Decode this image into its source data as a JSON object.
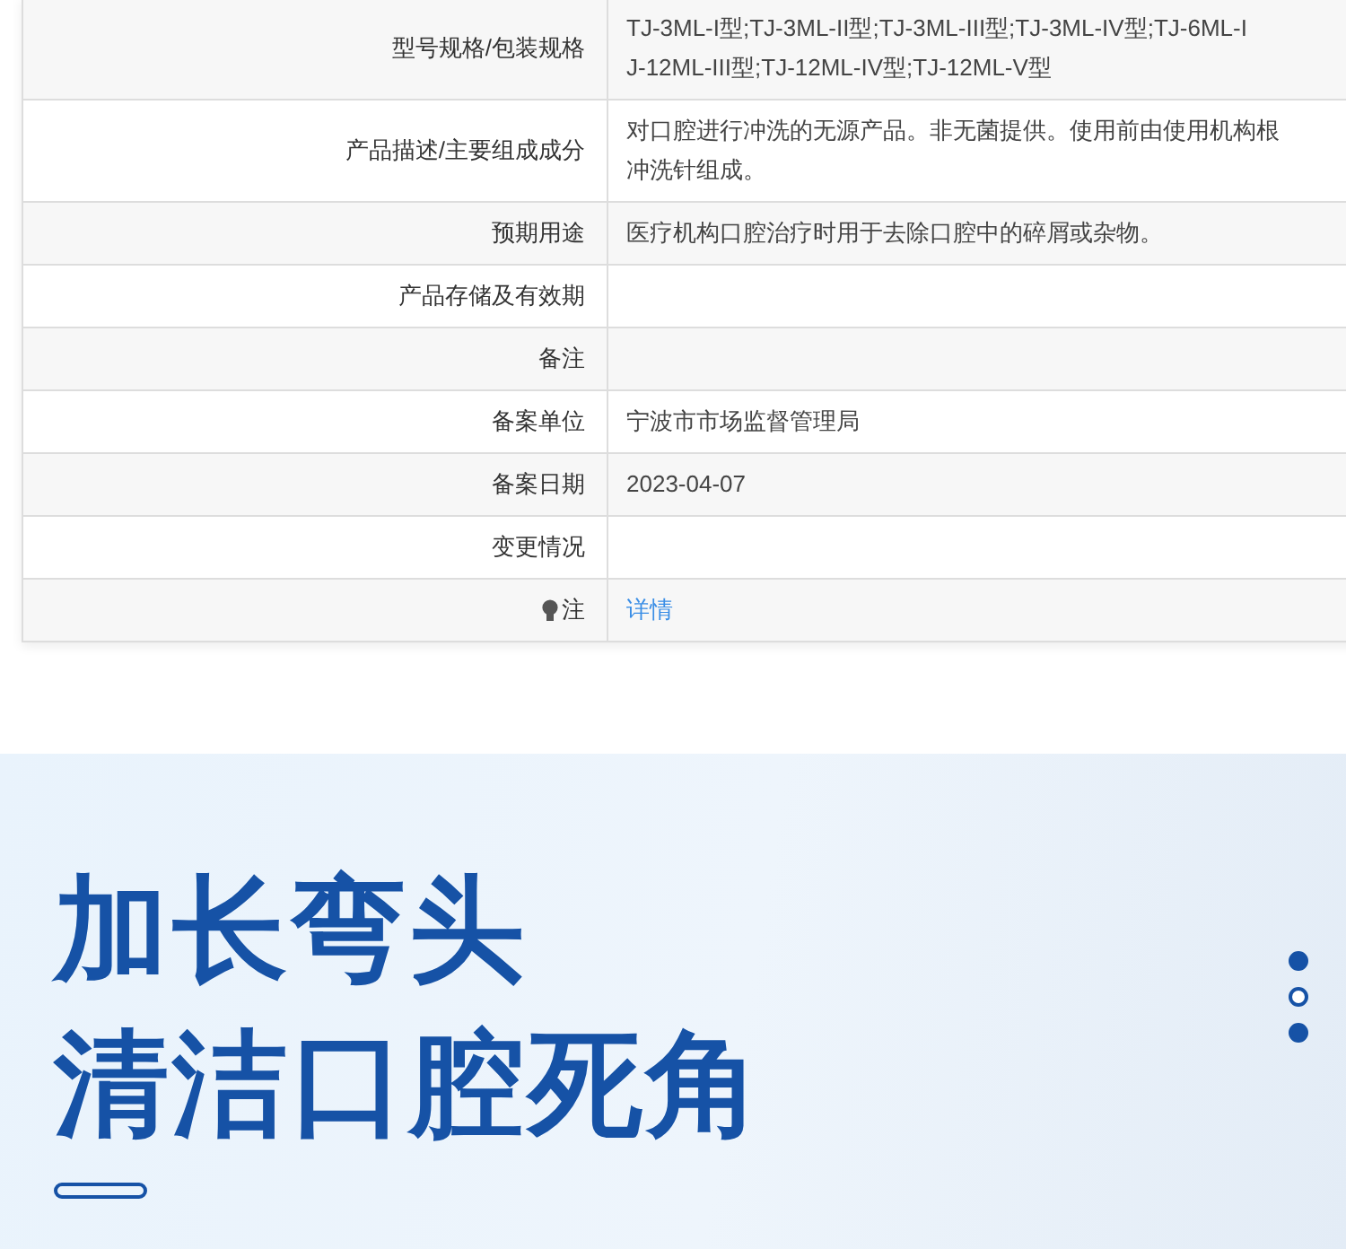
{
  "table": {
    "rows": [
      {
        "label": "型号规格/包装规格",
        "value": [
          "TJ-3ML-I型;TJ-3ML-II型;TJ-3ML-III型;TJ-3ML-IV型;TJ-6ML-I",
          "J-12ML-III型;TJ-12ML-IV型;TJ-12ML-V型"
        ]
      },
      {
        "label": "产品描述/主要组成成分",
        "value": [
          "对口腔进行冲洗的无源产品。非无菌提供。使用前由使用机构根",
          "冲洗针组成。"
        ]
      },
      {
        "label": "预期用途",
        "value": [
          "医疗机构口腔治疗时用于去除口腔中的碎屑或杂物。"
        ]
      },
      {
        "label": "产品存储及有效期"
      },
      {
        "label": "备注"
      },
      {
        "label": "备案单位",
        "value": [
          "宁波市市场监督管理局"
        ]
      },
      {
        "label": "备案日期",
        "value": [
          "2023-04-07"
        ]
      },
      {
        "label": "变更情况"
      },
      {
        "label": "注",
        "kind": "note",
        "link": "详情"
      }
    ]
  },
  "banner": {
    "headline": [
      "加长弯头",
      "清洁口腔死角"
    ],
    "dots": [
      {
        "selected": true
      },
      {
        "selected": false
      },
      {
        "selected": true
      }
    ]
  }
}
